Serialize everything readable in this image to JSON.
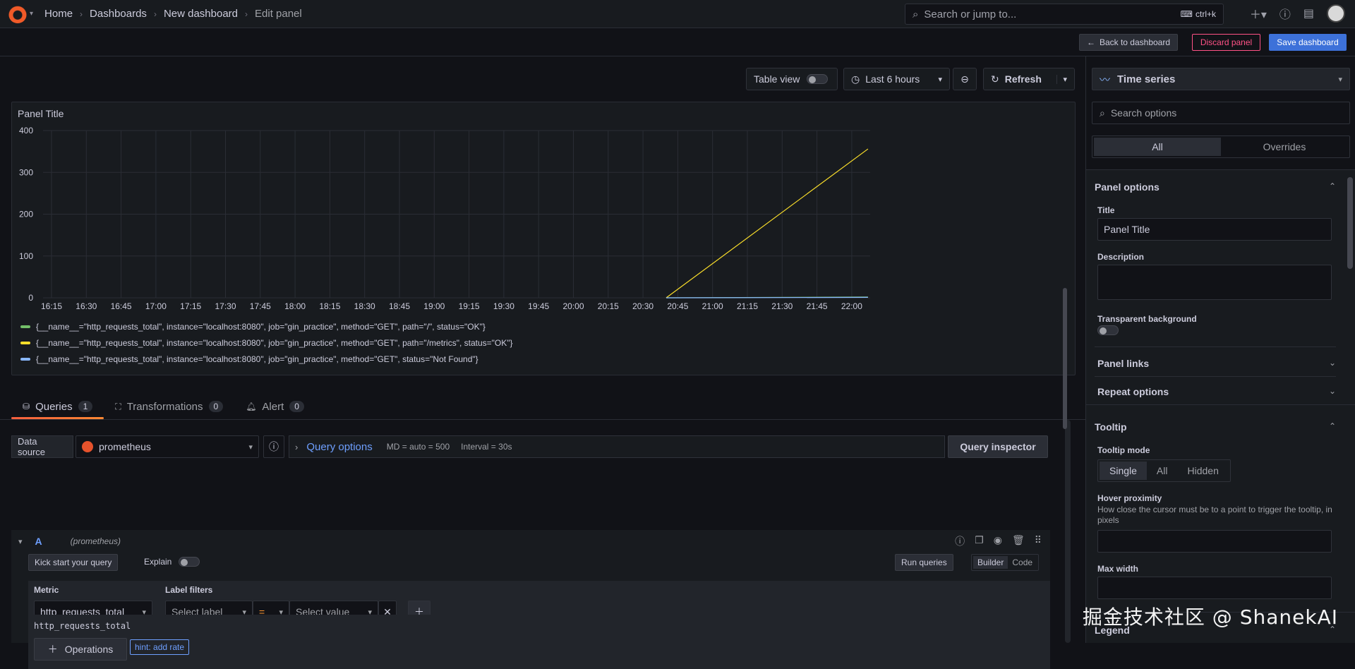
{
  "breadcrumb": {
    "home": "Home",
    "dashboards": "Dashboards",
    "new_dashboard": "New dashboard",
    "current": "Edit panel"
  },
  "search": {
    "placeholder": "Search or jump to...",
    "shortcut": "ctrl+k"
  },
  "actions": {
    "back": "Back to dashboard",
    "discard": "Discard panel",
    "save": "Save dashboard"
  },
  "toolbar": {
    "table_view": "Table view",
    "time_range": "Last 6 hours",
    "refresh": "Refresh"
  },
  "panel": {
    "title": "Panel Title"
  },
  "chart_data": {
    "type": "line",
    "y_ticks": [
      "400",
      "300",
      "200",
      "100",
      "0"
    ],
    "ylim": [
      0,
      400
    ],
    "x_ticks": [
      "16:15",
      "16:30",
      "16:45",
      "17:00",
      "17:15",
      "17:30",
      "17:45",
      "18:00",
      "18:15",
      "18:30",
      "18:45",
      "19:00",
      "19:15",
      "19:30",
      "19:45",
      "20:00",
      "20:15",
      "20:30",
      "20:45",
      "21:00",
      "21:15",
      "21:30",
      "21:45",
      "22:00"
    ],
    "series": [
      {
        "name": "{__name__=\"http_requests_total\", instance=\"localhost:8080\", job=\"gin_practice\", method=\"GET\", path=\"/\", status=\"OK\"}",
        "color": "#73bf69",
        "points": [
          [
            "20:40",
            0
          ],
          [
            "22:07",
            2
          ]
        ]
      },
      {
        "name": "{__name__=\"http_requests_total\", instance=\"localhost:8080\", job=\"gin_practice\", method=\"GET\", path=\"/metrics\", status=\"OK\"}",
        "color": "#fade2a",
        "points": [
          [
            "20:40",
            0
          ],
          [
            "22:07",
            356
          ]
        ]
      },
      {
        "name": "{__name__=\"http_requests_total\", instance=\"localhost:8080\", job=\"gin_practice\", method=\"GET\", status=\"Not Found\"}",
        "color": "#8ab8ff",
        "points": [
          [
            "20:40",
            0
          ],
          [
            "22:07",
            1
          ]
        ]
      }
    ]
  },
  "tabs": [
    {
      "label": "Queries",
      "count": "1"
    },
    {
      "label": "Transformations",
      "count": "0"
    },
    {
      "label": "Alert",
      "count": "0"
    }
  ],
  "query": {
    "data_source_label": "Data source",
    "data_source": "prometheus",
    "query_options": "Query options",
    "md": "MD = auto = 500",
    "interval": "Interval = 30s",
    "inspector": "Query inspector",
    "ref_id": "A",
    "ref_ds": "(prometheus)",
    "kick_start": "Kick start your query",
    "explain": "Explain",
    "run": "Run queries",
    "builder": "Builder",
    "code": "Code",
    "metric_label": "Metric",
    "metric_value": "http_requests_total",
    "label_filters": "Label filters",
    "select_label": "Select label",
    "operator": "=",
    "select_value": "Select value",
    "operations": "Operations",
    "hint": "hint: add rate",
    "preview": "http_requests_total"
  },
  "options": {
    "viz": "Time series",
    "search_placeholder": "Search options",
    "seg_all": "All",
    "seg_overrides": "Overrides",
    "panel_options": "Panel options",
    "title_label": "Title",
    "title_value": "Panel Title",
    "description_label": "Description",
    "transparent_label": "Transparent background",
    "panel_links": "Panel links",
    "repeat_options": "Repeat options",
    "tooltip": "Tooltip",
    "tooltip_mode": "Tooltip mode",
    "mode_single": "Single",
    "mode_all": "All",
    "mode_hidden": "Hidden",
    "hover_label": "Hover proximity",
    "hover_desc": "How close the cursor must be to a point to trigger the tooltip, in pixels",
    "max_width": "Max width",
    "legend": "Legend"
  },
  "watermark": "掘金技术社区 @ ShanekAI"
}
